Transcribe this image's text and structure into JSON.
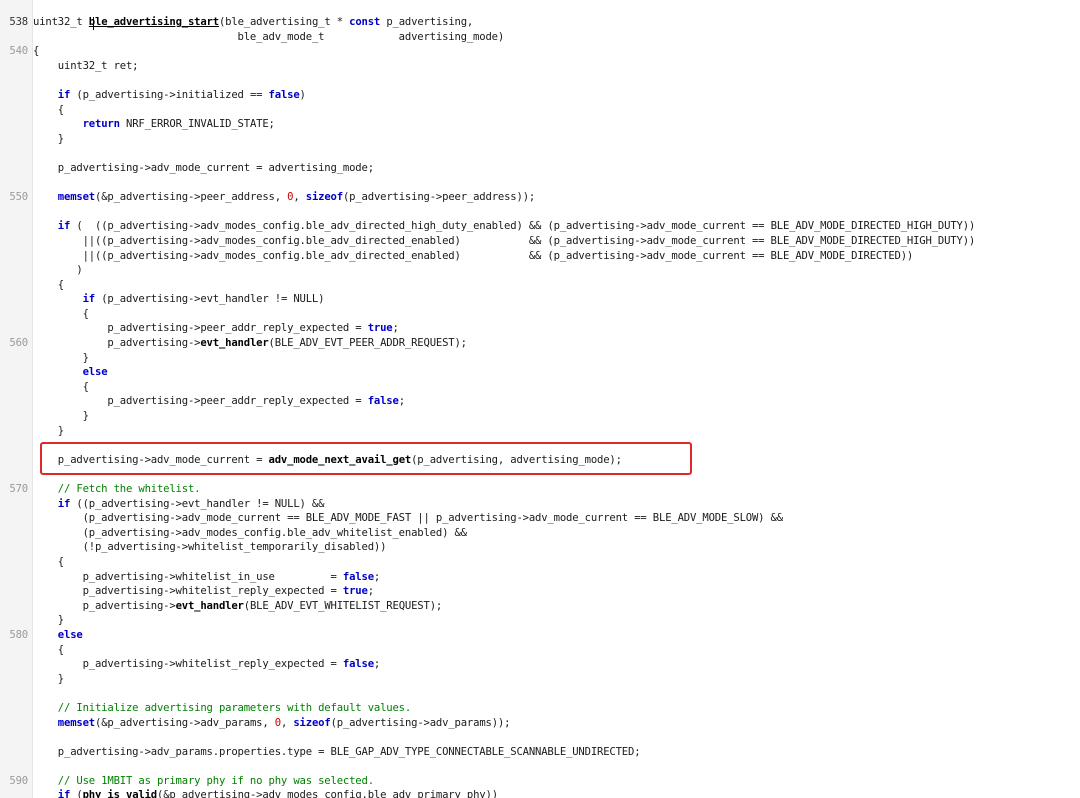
{
  "editor": {
    "line_numbers": {
      "l538": "538",
      "l540": "540",
      "l550": "550",
      "l560": "560",
      "l570": "570",
      "l580": "580",
      "l590": "590"
    },
    "lines": [
      {
        "ln": "538",
        "parts": [
          [
            "t",
            "uint32_t "
          ],
          [
            "bold ul",
            "ble_advertising_start"
          ],
          [
            "t",
            "(ble_advertising_t * "
          ],
          [
            "kw",
            "const"
          ],
          [
            "t",
            " p_advertising,"
          ]
        ]
      },
      {
        "ln": "",
        "parts": [
          [
            "t",
            "                                 ble_adv_mode_t            advertising_mode)"
          ]
        ]
      },
      {
        "ln": "540",
        "parts": [
          [
            "t",
            "{"
          ]
        ]
      },
      {
        "ln": "",
        "parts": [
          [
            "t",
            "    uint32_t ret;"
          ]
        ]
      },
      {
        "ln": "",
        "parts": [
          [
            "t",
            ""
          ]
        ]
      },
      {
        "ln": "",
        "parts": [
          [
            "t",
            "    "
          ],
          [
            "kw",
            "if"
          ],
          [
            "t",
            " (p_advertising->initialized == "
          ],
          [
            "kw",
            "false"
          ],
          [
            "t",
            ")"
          ]
        ]
      },
      {
        "ln": "",
        "parts": [
          [
            "t",
            "    {"
          ]
        ]
      },
      {
        "ln": "",
        "parts": [
          [
            "t",
            "        "
          ],
          [
            "kw",
            "return"
          ],
          [
            "t",
            " NRF_ERROR_INVALID_STATE;"
          ]
        ]
      },
      {
        "ln": "",
        "parts": [
          [
            "t",
            "    }"
          ]
        ]
      },
      {
        "ln": "",
        "parts": [
          [
            "t",
            ""
          ]
        ]
      },
      {
        "ln": "",
        "parts": [
          [
            "t",
            "    p_advertising->adv_mode_current = advertising_mode;"
          ]
        ]
      },
      {
        "ln": "",
        "parts": [
          [
            "t",
            ""
          ]
        ]
      },
      {
        "ln": "550",
        "parts": [
          [
            "t",
            "    "
          ],
          [
            "kw",
            "memset"
          ],
          [
            "t",
            "(&p_advertising->peer_address, "
          ],
          [
            "num",
            "0"
          ],
          [
            "t",
            ", "
          ],
          [
            "kw",
            "sizeof"
          ],
          [
            "t",
            "(p_advertising->peer_address));"
          ]
        ]
      },
      {
        "ln": "",
        "parts": [
          [
            "t",
            ""
          ]
        ]
      },
      {
        "ln": "",
        "parts": [
          [
            "t",
            "    "
          ],
          [
            "kw",
            "if"
          ],
          [
            "t",
            " (  ((p_advertising->adv_modes_config.ble_adv_directed_high_duty_enabled) && (p_advertising->adv_mode_current == BLE_ADV_MODE_DIRECTED_HIGH_DUTY))"
          ]
        ]
      },
      {
        "ln": "",
        "parts": [
          [
            "t",
            "        ||((p_advertising->adv_modes_config.ble_adv_directed_enabled)           && (p_advertising->adv_mode_current == BLE_ADV_MODE_DIRECTED_HIGH_DUTY))"
          ]
        ]
      },
      {
        "ln": "",
        "parts": [
          [
            "t",
            "        ||((p_advertising->adv_modes_config.ble_adv_directed_enabled)           && (p_advertising->adv_mode_current == BLE_ADV_MODE_DIRECTED))"
          ]
        ]
      },
      {
        "ln": "",
        "parts": [
          [
            "t",
            "       )"
          ]
        ]
      },
      {
        "ln": "",
        "parts": [
          [
            "t",
            "    {"
          ]
        ]
      },
      {
        "ln": "",
        "parts": [
          [
            "t",
            "        "
          ],
          [
            "kw",
            "if"
          ],
          [
            "t",
            " (p_advertising->evt_handler != NULL)"
          ]
        ]
      },
      {
        "ln": "",
        "parts": [
          [
            "t",
            "        {"
          ]
        ]
      },
      {
        "ln": "",
        "parts": [
          [
            "t",
            "            p_advertising->peer_addr_reply_expected = "
          ],
          [
            "kw",
            "true"
          ],
          [
            "t",
            ";"
          ]
        ]
      },
      {
        "ln": "560",
        "parts": [
          [
            "t",
            "            p_advertising->"
          ],
          [
            "bold",
            "evt_handler"
          ],
          [
            "t",
            "(BLE_ADV_EVT_PEER_ADDR_REQUEST);"
          ]
        ]
      },
      {
        "ln": "",
        "parts": [
          [
            "t",
            "        }"
          ]
        ]
      },
      {
        "ln": "",
        "parts": [
          [
            "t",
            "        "
          ],
          [
            "kw",
            "else"
          ]
        ]
      },
      {
        "ln": "",
        "parts": [
          [
            "t",
            "        {"
          ]
        ]
      },
      {
        "ln": "",
        "parts": [
          [
            "t",
            "            p_advertising->peer_addr_reply_expected = "
          ],
          [
            "kw",
            "false"
          ],
          [
            "t",
            ";"
          ]
        ]
      },
      {
        "ln": "",
        "parts": [
          [
            "t",
            "        }"
          ]
        ]
      },
      {
        "ln": "",
        "parts": [
          [
            "t",
            "    }"
          ]
        ]
      },
      {
        "ln": "",
        "parts": [
          [
            "t",
            ""
          ]
        ]
      },
      {
        "ln": "",
        "parts": [
          [
            "t",
            "    p_advertising->adv_mode_current = "
          ],
          [
            "bold",
            "adv_mode_next_avail_get"
          ],
          [
            "t",
            "(p_advertising, advertising_mode);"
          ]
        ]
      },
      {
        "ln": "",
        "parts": [
          [
            "t",
            ""
          ]
        ]
      },
      {
        "ln": "570",
        "parts": [
          [
            "cm",
            "    // Fetch the whitelist."
          ]
        ]
      },
      {
        "ln": "",
        "parts": [
          [
            "t",
            "    "
          ],
          [
            "kw",
            "if"
          ],
          [
            "t",
            " ((p_advertising->evt_handler != NULL) &&"
          ]
        ]
      },
      {
        "ln": "",
        "parts": [
          [
            "t",
            "        (p_advertising->adv_mode_current == BLE_ADV_MODE_FAST || p_advertising->adv_mode_current == BLE_ADV_MODE_SLOW) &&"
          ]
        ]
      },
      {
        "ln": "",
        "parts": [
          [
            "t",
            "        (p_advertising->adv_modes_config.ble_adv_whitelist_enabled) &&"
          ]
        ]
      },
      {
        "ln": "",
        "parts": [
          [
            "t",
            "        (!p_advertising->whitelist_temporarily_disabled))"
          ]
        ]
      },
      {
        "ln": "",
        "parts": [
          [
            "t",
            "    {"
          ]
        ]
      },
      {
        "ln": "",
        "parts": [
          [
            "t",
            "        p_advertising->whitelist_in_use         = "
          ],
          [
            "kw",
            "false"
          ],
          [
            "t",
            ";"
          ]
        ]
      },
      {
        "ln": "",
        "parts": [
          [
            "t",
            "        p_advertising->whitelist_reply_expected = "
          ],
          [
            "kw",
            "true"
          ],
          [
            "t",
            ";"
          ]
        ]
      },
      {
        "ln": "",
        "parts": [
          [
            "t",
            "        p_advertising->"
          ],
          [
            "bold",
            "evt_handler"
          ],
          [
            "t",
            "(BLE_ADV_EVT_WHITELIST_REQUEST);"
          ]
        ]
      },
      {
        "ln": "",
        "parts": [
          [
            "t",
            "    }"
          ]
        ]
      },
      {
        "ln": "580",
        "parts": [
          [
            "t",
            "    "
          ],
          [
            "kw",
            "else"
          ]
        ]
      },
      {
        "ln": "",
        "parts": [
          [
            "t",
            "    {"
          ]
        ]
      },
      {
        "ln": "",
        "parts": [
          [
            "t",
            "        p_advertising->whitelist_reply_expected = "
          ],
          [
            "kw",
            "false"
          ],
          [
            "t",
            ";"
          ]
        ]
      },
      {
        "ln": "",
        "parts": [
          [
            "t",
            "    }"
          ]
        ]
      },
      {
        "ln": "",
        "parts": [
          [
            "t",
            ""
          ]
        ]
      },
      {
        "ln": "",
        "parts": [
          [
            "cm",
            "    // Initialize advertising parameters with default values."
          ]
        ]
      },
      {
        "ln": "",
        "parts": [
          [
            "t",
            "    "
          ],
          [
            "kw",
            "memset"
          ],
          [
            "t",
            "(&p_advertising->adv_params, "
          ],
          [
            "num",
            "0"
          ],
          [
            "t",
            ", "
          ],
          [
            "kw",
            "sizeof"
          ],
          [
            "t",
            "(p_advertising->adv_params));"
          ]
        ]
      },
      {
        "ln": "",
        "parts": [
          [
            "t",
            ""
          ]
        ]
      },
      {
        "ln": "",
        "parts": [
          [
            "t",
            "    p_advertising->adv_params.properties.type = BLE_GAP_ADV_TYPE_CONNECTABLE_SCANNABLE_UNDIRECTED;"
          ]
        ]
      },
      {
        "ln": "",
        "parts": [
          [
            "t",
            ""
          ]
        ]
      },
      {
        "ln": "590",
        "parts": [
          [
            "cm",
            "    // Use 1MBIT as primary phy if no phy was selected."
          ]
        ]
      },
      {
        "ln": "",
        "parts": [
          [
            "t",
            "    "
          ],
          [
            "kw",
            "if"
          ],
          [
            "t",
            " ("
          ],
          [
            "bold",
            "phy_is_valid"
          ],
          [
            "t",
            "(&p_advertising->adv_modes_config.ble_adv_primary_phy))"
          ]
        ]
      }
    ],
    "highlight_color": "#e0272b",
    "keyword_color": "#0000c8",
    "comment_color": "#008000",
    "number_color": "#c80000"
  }
}
